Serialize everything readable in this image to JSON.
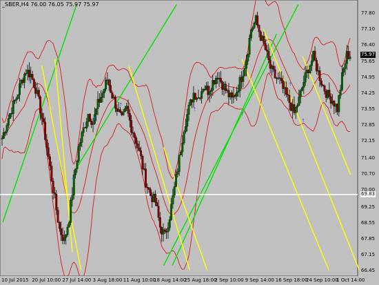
{
  "window": {
    "title": "_SBER,H4  76.00 76.05 75.97 75.97"
  },
  "colors": {
    "background": "#c0c0c0",
    "band": "#d81818",
    "bull_candle": "#006400",
    "bear_candle": "#8b0000",
    "channel_up": "#00e000",
    "channel_down": "#ffff00",
    "hline": "#ffffff",
    "marker": "#3355ff"
  },
  "price_axis": {
    "ticks": [
      "77.80",
      "77.10",
      "76.40",
      "75.65",
      "74.95",
      "74.25",
      "73.55",
      "72.85",
      "72.15",
      "71.40",
      "70.70",
      "70.00",
      "69.25",
      "68.55",
      "67.85",
      "67.15",
      "66.45"
    ],
    "current_price": "75.97",
    "hline_price": "69.83"
  },
  "time_axis": {
    "labels": [
      "10 Jul 2015",
      "20 Jul 10:00",
      "27 Jul 14:00",
      "3 Aug 18:00",
      "11 Aug 10:00",
      "18 Aug 14:00",
      "25 Aug 18:00",
      "2 Sep 10:00",
      "9 Sep 14:00",
      "16 Sep 18:00",
      "24 Sep 10:00",
      "1 Oct 14:00"
    ]
  },
  "chart_data": {
    "type": "candlestick",
    "symbol": "_SBER",
    "timeframe": "H4",
    "ohlc_last": {
      "open": 76.0,
      "high": 76.05,
      "low": 75.97,
      "close": 75.97
    },
    "ylim": [
      66.45,
      78.15
    ],
    "close_path": [
      72.3,
      73.0,
      73.6,
      74.1,
      74.8,
      75.3,
      75.1,
      74.5,
      73.6,
      72.4,
      71.0,
      69.6,
      68.3,
      67.8,
      68.8,
      70.5,
      71.9,
      72.7,
      73.4,
      73.0,
      73.8,
      74.3,
      74.9,
      74.2,
      73.6,
      73.1,
      73.6,
      72.8,
      72.2,
      71.4,
      70.4,
      69.8,
      69.5,
      68.4,
      68.0,
      68.9,
      70.1,
      71.4,
      72.8,
      73.6,
      74.3,
      74.1,
      74.6,
      74.4,
      74.8,
      75.1,
      74.7,
      74.3,
      74.0,
      74.4,
      75.0,
      75.8,
      77.1,
      77.5,
      76.8,
      76.2,
      75.4,
      75.0,
      74.8,
      74.3,
      73.9,
      73.4,
      74.0,
      74.8,
      75.4,
      75.9,
      75.2,
      74.6,
      74.2,
      74.0,
      73.6,
      75.0,
      75.97
    ],
    "markers": [
      {
        "index": 1,
        "price": 73.4
      },
      {
        "index": 6,
        "price": 74.8
      },
      {
        "index": 16,
        "price": 70.5
      },
      {
        "index": 21,
        "price": 73.2
      },
      {
        "index": 27,
        "price": 73.8
      },
      {
        "index": 34,
        "price": 69.7
      },
      {
        "index": 44,
        "price": 73.6
      },
      {
        "index": 51,
        "price": 74.6
      },
      {
        "index": 55,
        "price": 73.4
      },
      {
        "index": 62,
        "price": 75.3
      },
      {
        "index": 66,
        "price": 74.7
      },
      {
        "index": 69,
        "price": 73.1
      }
    ],
    "channels_up": [
      {
        "x1": 0,
        "p1": 68.6,
        "x2": 17,
        "p2": 78.2
      },
      {
        "x1": 17,
        "p1": 71.0,
        "x2": 40,
        "p2": 78.2
      },
      {
        "x1": 37,
        "p1": 66.7,
        "x2": 68,
        "p2": 78.2
      },
      {
        "x1": 39,
        "p1": 66.7,
        "x2": 63,
        "p2": 76.9
      }
    ],
    "channels_down": [
      {
        "x1": 9,
        "p1": 75.5,
        "x2": 18,
        "p2": 66.5
      },
      {
        "x1": 12,
        "p1": 75.8,
        "x2": 16,
        "p2": 67.3
      },
      {
        "x1": 29,
        "p1": 75.5,
        "x2": 43,
        "p2": 66.5
      },
      {
        "x1": 37,
        "p1": 71.9,
        "x2": 47,
        "p2": 66.5
      },
      {
        "x1": 55,
        "p1": 75.8,
        "x2": 75,
        "p2": 66.5
      },
      {
        "x1": 60,
        "p1": 77.1,
        "x2": 82,
        "p2": 66.5
      },
      {
        "x1": 69,
        "p1": 75.9,
        "x2": 80,
        "p2": 70.7
      }
    ]
  }
}
